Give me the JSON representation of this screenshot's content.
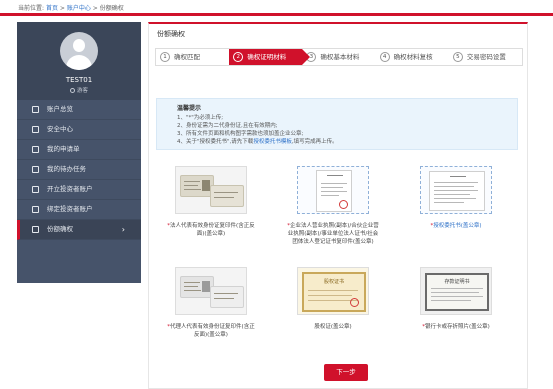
{
  "breadcrumb": {
    "label": "当前位置:",
    "home": "首页",
    "sep1": ">",
    "account": "账户中心",
    "sep2": ">",
    "current": "份额确权"
  },
  "sidebar": {
    "username": "TEST01",
    "role": "游客",
    "items": [
      {
        "label": "账户总览",
        "icon": "user-icon"
      },
      {
        "label": "安全中心",
        "icon": "shield-icon"
      },
      {
        "label": "我的申请单",
        "icon": "document-icon"
      },
      {
        "label": "我的待办任务",
        "icon": "task-icon"
      },
      {
        "label": "开立投资者账户",
        "icon": "open-account-icon"
      },
      {
        "label": "绑定投资者账户",
        "icon": "bind-account-icon"
      },
      {
        "label": "份额确权",
        "icon": "share-icon",
        "arrow": "›"
      }
    ]
  },
  "panel": {
    "title": "份额确权",
    "steps": [
      {
        "num": "1",
        "label": "确权匹配"
      },
      {
        "num": "2",
        "label": "确权证明材料"
      },
      {
        "num": "3",
        "label": "确权基本材料"
      },
      {
        "num": "4",
        "label": "确权材料复核"
      },
      {
        "num": "5",
        "label": "交易密码设置"
      }
    ],
    "tips": {
      "heading": "温馨提示",
      "line1": "1、\"*\"为必须上传;",
      "line2": "2、身份证需为二代身份证,且在有效期内;",
      "line3": "3、所有文件页面和机构图字需款也须加盖企业公章;",
      "line4_pre": "4、关于\"授权委托书\",请先下载",
      "line4_link": "授权委托书模板",
      "line4_post": ",填写完成再上传。"
    },
    "docs": [
      {
        "req": "*",
        "caption": "法人代表有效身份证复印件(含正反面)(盖公章)"
      },
      {
        "req": "*",
        "caption": "企业法人营业执照(副本)/合伙企业营业执照(副本)/事业单位法人证书/社会团体法人登记证书复印件(盖公章)"
      },
      {
        "req": "*",
        "caption": "授权委托书(盖公章)"
      },
      {
        "req": "*",
        "caption": "代理人代表有效身份证复印件(含正反面)(盖公章)"
      },
      {
        "req": "",
        "caption": "股权证(盖公章)"
      },
      {
        "req": "*",
        "caption": "银行卡或存折照片(盖公章)"
      }
    ],
    "doc_images": {
      "cert_title": "营业执照",
      "share_title": "股权证书",
      "bank_title": "存款证明书"
    },
    "next_button": "下一步"
  },
  "colors": {
    "accent": "#d0112b",
    "sidebar": "#46536a",
    "link": "#2f72c8"
  }
}
